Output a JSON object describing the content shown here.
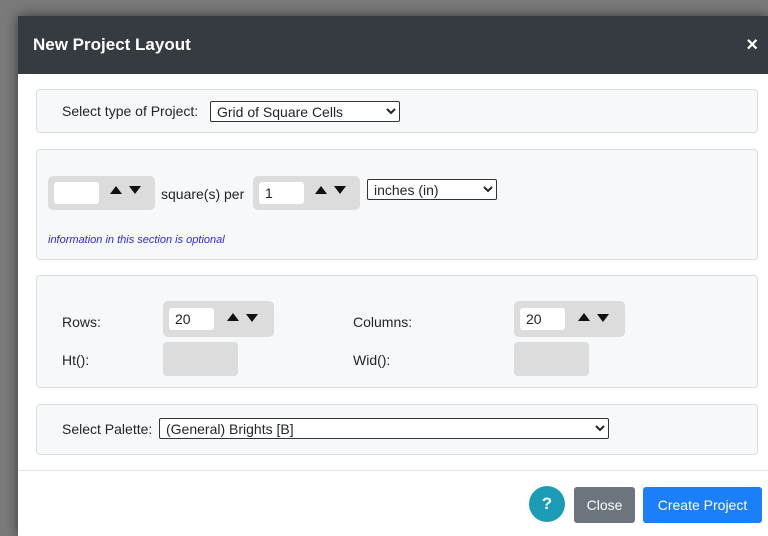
{
  "dialog": {
    "title": "New Project Layout",
    "close_glyph": "×"
  },
  "project_type": {
    "label": "Select type of Project:",
    "selected": "Grid of Square Cells"
  },
  "scale": {
    "squares_value": "",
    "squares_per_label": "square(s) per",
    "per_value": "1",
    "unit_selected": "inches (in)",
    "optional_note": "information in this section is optional"
  },
  "dimensions": {
    "rows_label": "Rows:",
    "rows_value": "20",
    "columns_label": "Columns:",
    "columns_value": "20",
    "ht_label": "Ht():",
    "wid_label": "Wid():"
  },
  "palette": {
    "label": "Select Palette:",
    "selected": "(General) Brights [B]"
  },
  "footer": {
    "help_label": "?",
    "close_label": "Close",
    "create_label": "Create Project"
  },
  "icons": {
    "close": "close-icon",
    "up": "arrow-up-icon",
    "down": "arrow-down-icon",
    "help": "question-icon"
  },
  "colors": {
    "header_bg": "#353b41",
    "primary": "#1a7ff8",
    "secondary": "#6c757d",
    "info": "#1b9bb6",
    "note_text": "#2b2bd8"
  }
}
